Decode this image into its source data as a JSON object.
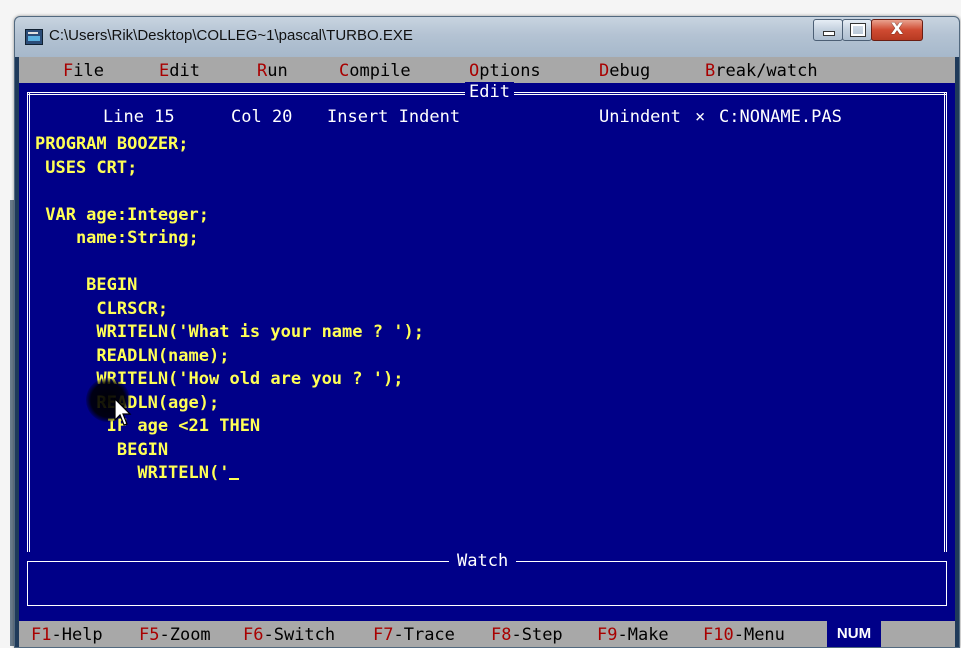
{
  "window": {
    "title": "C:\\Users\\Rik\\Desktop\\COLLEG~1\\pascal\\TURBO.EXE",
    "close_glyph": "X"
  },
  "menu": {
    "items": [
      {
        "hot": "F",
        "rest": "ile"
      },
      {
        "hot": "E",
        "rest": "dit"
      },
      {
        "hot": "R",
        "rest": "un"
      },
      {
        "hot": "C",
        "rest": "ompile"
      },
      {
        "hot": "O",
        "rest": "ptions"
      },
      {
        "hot": "D",
        "rest": "ebug"
      },
      {
        "hot": "B",
        "rest": "reak/watch"
      }
    ]
  },
  "editor": {
    "window_title": "Edit",
    "status": {
      "line": "Line 15",
      "col": "Col 20",
      "modes": "Insert Indent",
      "unindent": "Unindent",
      "modified_marker": "×",
      "filename": "C:NONAME.PAS"
    },
    "code_lines": [
      "PROGRAM BOOZER;",
      " USES CRT;",
      "",
      " VAR age:Integer;",
      "    name:String;",
      "",
      "     BEGIN",
      "      CLRSCR;",
      "      WRITELN('What is your name ? ');",
      "      READLN(name);",
      "      WRITELN('How old are you ? ');",
      "      READLN(age);",
      "       IF age <21 THEN",
      "        BEGIN",
      "          WRITELN('"
    ]
  },
  "watch": {
    "title": "Watch"
  },
  "fkeys": [
    {
      "key": "F1",
      "label": "-Help"
    },
    {
      "key": "F5",
      "label": "-Zoom"
    },
    {
      "key": "F6",
      "label": "-Switch"
    },
    {
      "key": "F7",
      "label": "-Trace"
    },
    {
      "key": "F8",
      "label": "-Step"
    },
    {
      "key": "F9",
      "label": "-Make"
    },
    {
      "key": "F10",
      "label": "-Menu"
    }
  ],
  "indicator": {
    "num": "NUM"
  },
  "colors": {
    "screen_bg": "#000088",
    "code_text": "#ffff55",
    "menu_bg": "#a8a8a8",
    "hotkey": "#a80000"
  }
}
